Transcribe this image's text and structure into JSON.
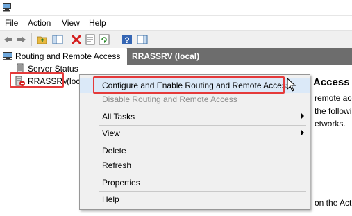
{
  "menubar": {
    "items": [
      {
        "label": "File"
      },
      {
        "label": "Action"
      },
      {
        "label": "View"
      },
      {
        "label": "Help"
      }
    ]
  },
  "tree": {
    "root": {
      "label": "Routing and Remote Access",
      "icon": "rras-icon"
    },
    "items": [
      {
        "label": "Server Status",
        "icon": "server-status-icon"
      },
      {
        "label": "RRASSRV",
        "suffix": "(loca",
        "icon": "server-down-icon"
      }
    ]
  },
  "right_pane": {
    "header": "RRASSRV (local)",
    "heading": "Access",
    "lines": [
      "remote acc",
      "the followin",
      "etworks.",
      "on the Act"
    ]
  },
  "context_menu": {
    "items": [
      {
        "label": "Configure and Enable Routing and Remote Access",
        "state": "highlighted"
      },
      {
        "label": "Disable Routing and Remote Access",
        "state": "disabled"
      },
      {
        "label": "All Tasks",
        "has_submenu": true
      },
      {
        "label": "View",
        "has_submenu": true
      },
      {
        "label": "Delete"
      },
      {
        "label": "Refresh"
      },
      {
        "label": "Properties"
      },
      {
        "label": "Help"
      }
    ]
  },
  "colors": {
    "highlight_box": "#e53a3a",
    "pane_header_bg": "#6d6d6d",
    "menu_bg": "#f0f0f0",
    "selected_item_bg": "#dbe9f8"
  }
}
